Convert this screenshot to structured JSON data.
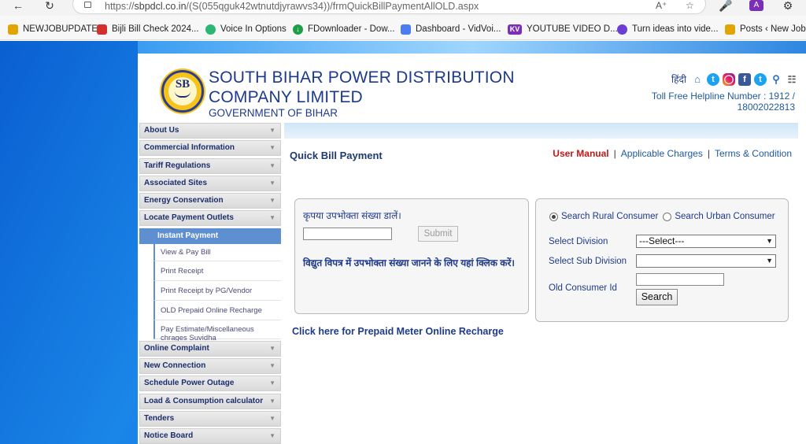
{
  "browser": {
    "url_host": "sbpdcl.co.in",
    "url_path": "/(S(055qguk42wtnutdjyrawvs34))/frmQuickBillPaymentAllOLD.aspx",
    "bookmarks": [
      {
        "label": "NEWJOBUPDATE",
        "icon": "folder-icon",
        "color": "#e2a400"
      },
      {
        "label": "Bijli Bill Check 2024...",
        "icon": "bookmark-icon",
        "color": "#d32f2f"
      },
      {
        "label": "Voice In Options",
        "icon": "voice-icon",
        "color": "#2bb673"
      },
      {
        "label": "FDownloader - Dow...",
        "icon": "download-icon",
        "color": "#1e9e46"
      },
      {
        "label": "Dashboard - VidVoi...",
        "icon": "vidvoice-icon",
        "color": "#4a7ef0"
      },
      {
        "label": "YOUTUBE VIDEO D...",
        "icon": "kv-icon",
        "color": "#7b2fb5"
      },
      {
        "label": "Turn ideas into vide...",
        "icon": "sparkle-icon",
        "color": "#6a3fd1"
      },
      {
        "label": "Posts ‹ New Job U",
        "icon": "folder-icon",
        "color": "#e2a400"
      }
    ]
  },
  "header": {
    "title": "SOUTH BIHAR POWER DISTRIBUTION COMPANY LIMITED",
    "subtitle": "GOVERNMENT OF BIHAR",
    "logo_text": "SB",
    "hindi_link": "हिंदी",
    "helpline": "Toll Free Helpline Number : 1912 / 18002022813"
  },
  "sidebar": {
    "items_top": [
      "About Us",
      "Commercial Information",
      "Tariff Regulations",
      "Associated Sites",
      "Energy Conservation",
      "Locate Payment Outlets"
    ],
    "active_sub": "Instant Payment",
    "sub_items": [
      "View & Pay Bill",
      "Print Receipt",
      "Print Receipt by PG/Vendor",
      "OLD Prepaid Online Recharge",
      "Pay Estimate/Miscellaneous chrages Suvidha"
    ],
    "items_bottom": [
      "Online Complaint",
      "New Connection",
      "Schedule Power Outage",
      "Load & Consumption calculator",
      "Tenders",
      "Notice Board"
    ]
  },
  "main": {
    "heading": "Quick Bill Payment",
    "user_manual": "User Manual",
    "applicable_charges": "Applicable Charges",
    "terms": "Terms & Condition",
    "left_box": {
      "label": "कृपया उपभोक्ता संख्या डालें।",
      "input_value": "",
      "submit_label": "Submit",
      "info_text": "विद्युत विपत्र में उपभोक्ता संख्या जानने के लिए यहां क्लिक करें।"
    },
    "right_box": {
      "radio_rural": "Search Rural Consumer",
      "radio_urban": "Search Urban Consumer",
      "selected_radio": "rural",
      "division_label": "Select Division",
      "division_value": "---Select---",
      "subdivision_label": "Select Sub Division",
      "subdivision_value": "",
      "old_id_label": "Old Consumer Id",
      "old_id_value": "",
      "search_label": "Search"
    },
    "prepaid_link": "Click here for Prepaid Meter Online Recharge"
  }
}
